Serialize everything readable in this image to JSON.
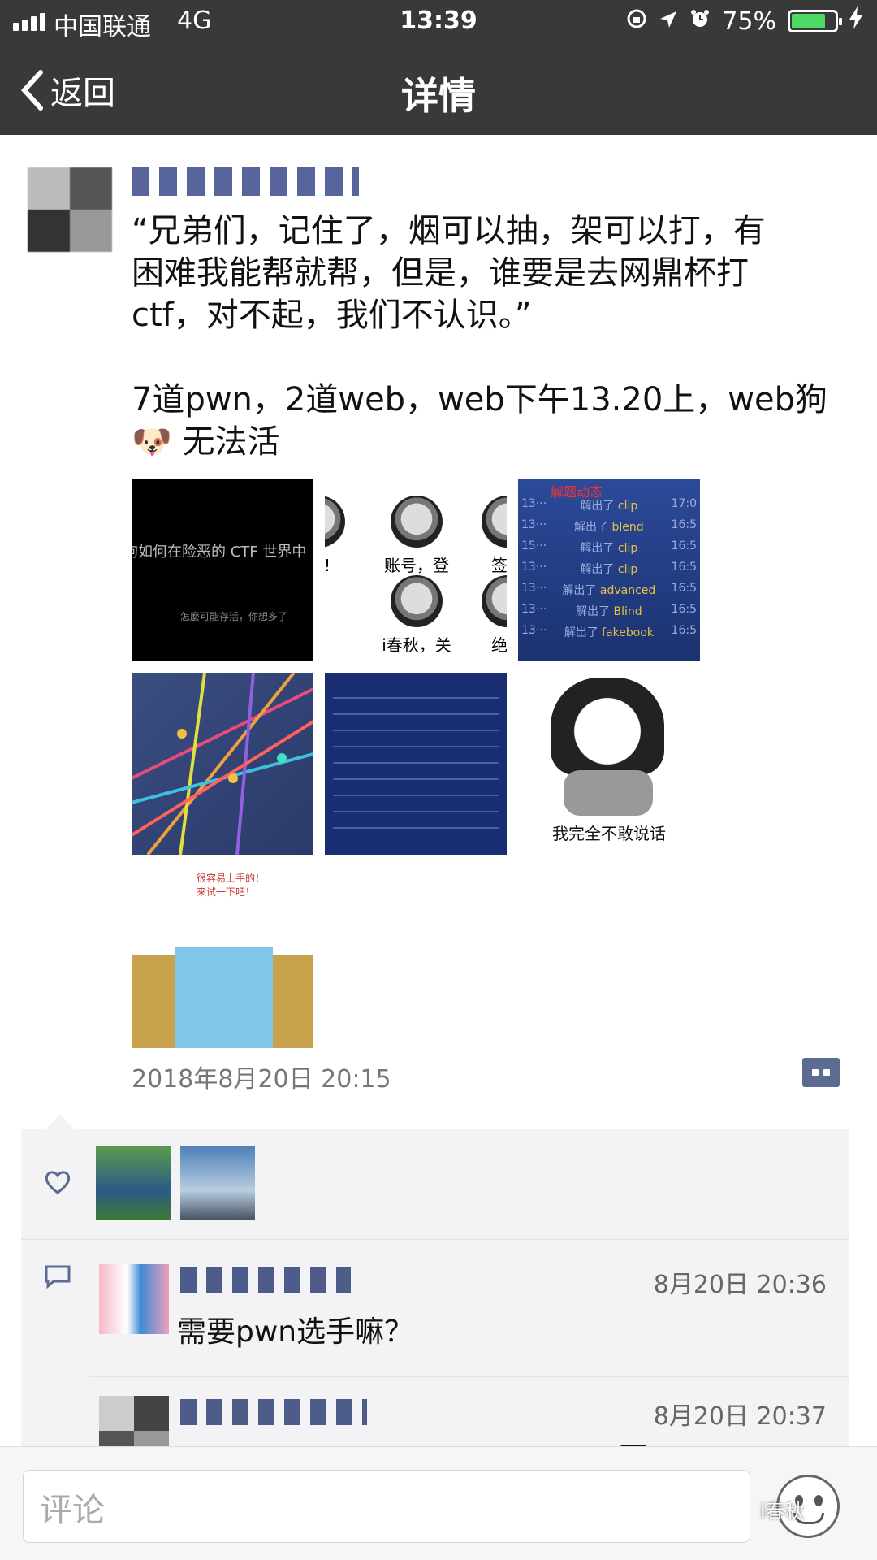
{
  "status_bar": {
    "carrier": "中国联通",
    "network": "4G",
    "time": "13:39",
    "battery": "75%",
    "battery_level": 0.75
  },
  "nav": {
    "back_label": "返回",
    "title": "详情"
  },
  "post": {
    "text_lines": [
      "“兄弟们，记住了，烟可以抽，架可以打，有",
      "困难我能帮就帮，但是，谁要是去网鼎杯打",
      "ctf，对不起，我们不认识。”"
    ],
    "text_lines_2": [
      "7道pwn，2道web，web下午13.20上，web狗",
      "🐶 无法活"
    ],
    "images": {
      "img1_line1": "狗如何在险恶的 CTF 世界中",
      "img1_line2": "怎麼可能存活，你想多了",
      "img2_cells": [
        "动!",
        "账号，登录！",
        "签到",
        "i春秋，关闭！",
        "绝地"
      ],
      "img3_header": "解题动态",
      "img3_rows": [
        {
          "idx": "13···",
          "text": "解出了",
          "name": "clip",
          "time": "17:0"
        },
        {
          "idx": "13···",
          "text": "解出了",
          "name": "blend",
          "time": "16:5"
        },
        {
          "idx": "15···",
          "text": "解出了",
          "name": "clip",
          "time": "16:5"
        },
        {
          "idx": "13···",
          "text": "解出了",
          "name": "clip",
          "time": "16:5"
        },
        {
          "idx": "13···",
          "text": "解出了",
          "name": "advanced",
          "time": "16:5"
        },
        {
          "idx": "13···",
          "text": "解出了",
          "name": "Blind",
          "time": "16:5"
        },
        {
          "idx": "13···",
          "text": "解出了",
          "name": "fakebook",
          "time": "16:5"
        }
      ],
      "img6_caption": "我完全不敢说话",
      "img7_bubble": "很容易上手的！来试一下吧！"
    },
    "timestamp": "2018年8月20日 20:15"
  },
  "comments": [
    {
      "time": "8月20日 20:36",
      "text": "需要pwn选手嘛？"
    },
    {
      "time": "8月20日 20:37",
      "text": "要"
    }
  ],
  "comment_input": {
    "placeholder": "评论"
  },
  "watermark": "i春秋",
  "colors": {
    "bar_bg": "#393939",
    "link_blue": "#5b6b92",
    "battery_green": "#4cd964",
    "panel_bg": "#f3f3f5"
  }
}
